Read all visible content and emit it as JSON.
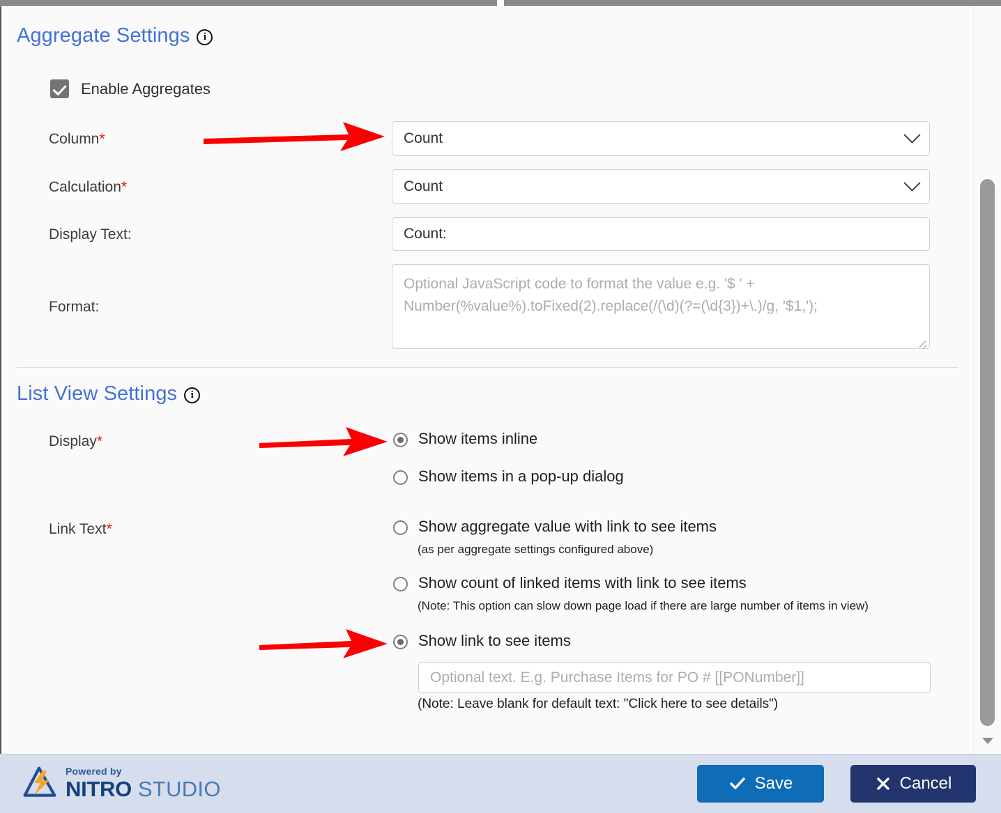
{
  "aggregate": {
    "title": "Aggregate Settings",
    "info_icon": "info-icon",
    "enable_label": "Enable Aggregates",
    "enable_checked": true,
    "fields": {
      "column_label": "Column",
      "column_required": "*",
      "column_value": "Count",
      "calculation_label": "Calculation",
      "calculation_required": "*",
      "calculation_value": "Count",
      "display_text_label": "Display Text:",
      "display_text_value": "Count:",
      "format_label": "Format:",
      "format_placeholder": "Optional JavaScript code to format the value e.g. '$ ' + Number(%value%).toFixed(2).replace(/(\\d)(?=(\\d{3})+\\.)/g, '$1,');"
    }
  },
  "list_view": {
    "title": "List View Settings",
    "info_icon": "info-icon",
    "display_label": "Display",
    "display_required": "*",
    "display_options": [
      {
        "label": "Show items inline",
        "selected": true
      },
      {
        "label": "Show items in a pop-up dialog",
        "selected": false
      }
    ],
    "link_text_label": "Link Text",
    "link_text_required": "*",
    "link_text_options": [
      {
        "label": "Show aggregate value with link to see items",
        "note": "(as per aggregate settings configured above)",
        "selected": false
      },
      {
        "label": "Show count of linked items with link to see items",
        "note": "(Note: This option can slow down page load if there are large number of items in view)",
        "selected": false
      },
      {
        "label": "Show link to see items",
        "note": "(Note: Leave blank for default text: \"Click here to see details\")",
        "selected": true,
        "input_placeholder": "Optional text. E.g. Purchase Items for PO # [[PONumber]]"
      }
    ]
  },
  "footer": {
    "powered_by": "Powered by",
    "brand_primary": "NITRO",
    "brand_secondary": " STUDIO",
    "save_label": "Save",
    "cancel_label": "Cancel"
  },
  "colors": {
    "section_title": "#4472d4",
    "required_star": "#e81313",
    "annotation_arrow": "#fb0000",
    "save_button": "#0f6cb6",
    "cancel_button": "#22356e",
    "footer_bg": "#d6dded",
    "panel_bg": "#fafafa"
  }
}
